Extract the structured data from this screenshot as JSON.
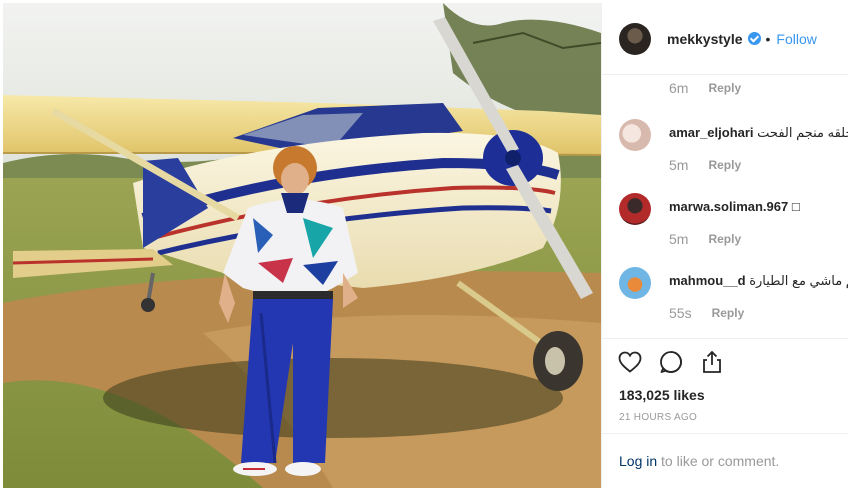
{
  "post": {
    "username": "mekkystyle",
    "follow_label": "Follow",
    "separator": "•"
  },
  "comments": {
    "top_partial": {
      "time": "6m",
      "reply_label": "Reply"
    },
    "items": [
      {
        "username": "amar_eljohari",
        "text": "حلقه منجم الفحت",
        "time": "5m",
        "reply_label": "Reply",
        "avatar_color": "#e8d7cf"
      },
      {
        "username": "marwa.soliman.967",
        "text": "□",
        "time": "5m",
        "reply_label": "Reply",
        "avatar_color": "#b22a2a"
      },
      {
        "username": "mahmou__d",
        "text": "لقم ماشي مع الطيارة",
        "time": "55s",
        "reply_label": "Reply",
        "avatar_color": "#6fb6e4"
      }
    ]
  },
  "actions": {
    "likes": "183,025 likes",
    "time_ago": "21 HOURS AGO",
    "icons": [
      "heart-icon",
      "comment-icon",
      "share-icon"
    ]
  },
  "footer": {
    "login_link": "Log in",
    "login_rest": " to like or comment."
  },
  "colors": {
    "accent": "#3897f0",
    "muted": "#999999",
    "link": "#003569"
  }
}
